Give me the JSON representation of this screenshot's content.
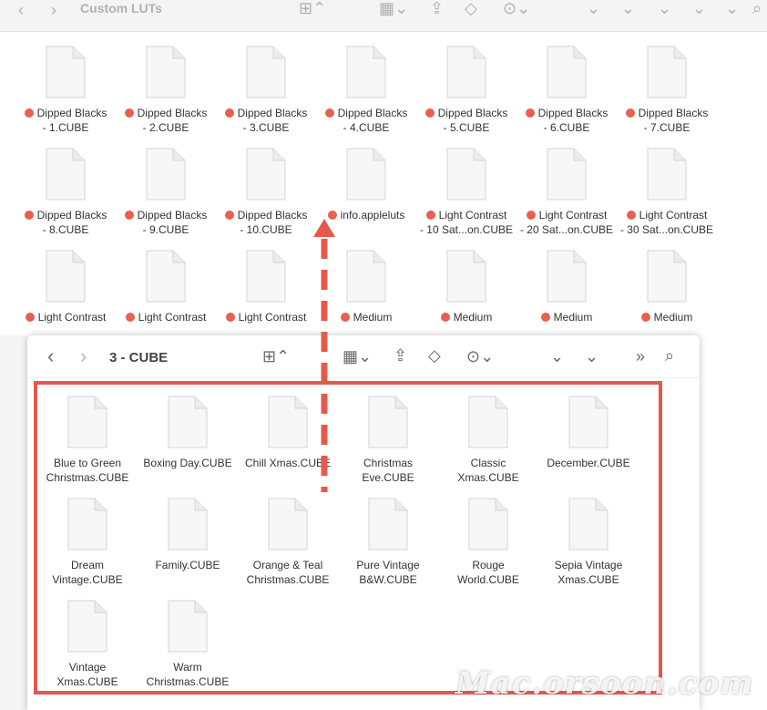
{
  "back_window": {
    "title": "Custom LUTs",
    "toolbar_icons": [
      "back-arrow-icon",
      "forward-arrow-icon",
      "grid-view-icon",
      "group-icon",
      "share-icon",
      "tag-icon",
      "more-icon",
      "chevron-down-icon",
      "search-icon"
    ],
    "rows": [
      [
        {
          "line1": "Dipped Blacks",
          "line2": "- 1.CUBE",
          "tag": true
        },
        {
          "line1": "Dipped Blacks",
          "line2": "- 2.CUBE",
          "tag": true
        },
        {
          "line1": "Dipped Blacks",
          "line2": "- 3.CUBE",
          "tag": true
        },
        {
          "line1": "Dipped Blacks",
          "line2": "- 4.CUBE",
          "tag": true
        },
        {
          "line1": "Dipped Blacks",
          "line2": "- 5.CUBE",
          "tag": true
        },
        {
          "line1": "Dipped Blacks",
          "line2": "- 6.CUBE",
          "tag": true
        },
        {
          "line1": "Dipped Blacks",
          "line2": "- 7.CUBE",
          "tag": true
        }
      ],
      [
        {
          "line1": "Dipped Blacks",
          "line2": "- 8.CUBE",
          "tag": true
        },
        {
          "line1": "Dipped Blacks",
          "line2": "- 9.CUBE",
          "tag": true
        },
        {
          "line1": "Dipped Blacks",
          "line2": "- 10.CUBE",
          "tag": true
        },
        {
          "line1": "info.appleluts",
          "line2": "",
          "tag": true
        },
        {
          "line1": "Light Contrast",
          "line2": "- 10 Sat...on.CUBE",
          "tag": true
        },
        {
          "line1": "Light Contrast",
          "line2": "- 20 Sat...on.CUBE",
          "tag": true
        },
        {
          "line1": "Light Contrast",
          "line2": "- 30 Sat...on.CUBE",
          "tag": true
        }
      ],
      [
        {
          "line1": "Light Contrast",
          "line2": "",
          "tag": true
        },
        {
          "line1": "Light Contrast",
          "line2": "",
          "tag": true
        },
        {
          "line1": "Light Contrast",
          "line2": "",
          "tag": true
        },
        {
          "line1": "Medium",
          "line2": "",
          "tag": true
        },
        {
          "line1": "Medium",
          "line2": "",
          "tag": true
        },
        {
          "line1": "Medium",
          "line2": "",
          "tag": true
        },
        {
          "line1": "Medium",
          "line2": "",
          "tag": true
        }
      ]
    ]
  },
  "front_window": {
    "title": "3 - CUBE",
    "toolbar_icons": [
      "back-arrow-icon",
      "forward-arrow-icon",
      "grid-view-icon",
      "group-icon",
      "share-icon",
      "tag-icon",
      "more-icon",
      "chevron-down-icon",
      "expand-icon",
      "search-icon"
    ],
    "files": [
      [
        "Blue to Green",
        "Christmas.CUBE"
      ],
      [
        "Boxing Day.CUBE",
        ""
      ],
      [
        "Chill Xmas.CUBE",
        ""
      ],
      [
        "Christmas",
        "Eve.CUBE"
      ],
      [
        "Classic",
        "Xmas.CUBE"
      ],
      [
        "December.CUBE",
        ""
      ],
      [
        "Dream",
        "Vintage.CUBE"
      ],
      [
        "Family.CUBE",
        ""
      ],
      [
        "Orange & Teal",
        "Christmas.CUBE"
      ],
      [
        "Pure Vintage",
        "B&W.CUBE"
      ],
      [
        "Rouge",
        "World.CUBE"
      ],
      [
        "Sepia Vintage",
        "Xmas.CUBE"
      ],
      [
        "Vintage",
        "Xmas.CUBE"
      ],
      [
        "Warm",
        "Christmas.CUBE"
      ]
    ]
  },
  "watermark": "Mac.orsoon.com",
  "colors": {
    "tag": "#e8604f",
    "highlight": "#e35a4c",
    "arrow": "#e35a4c"
  }
}
